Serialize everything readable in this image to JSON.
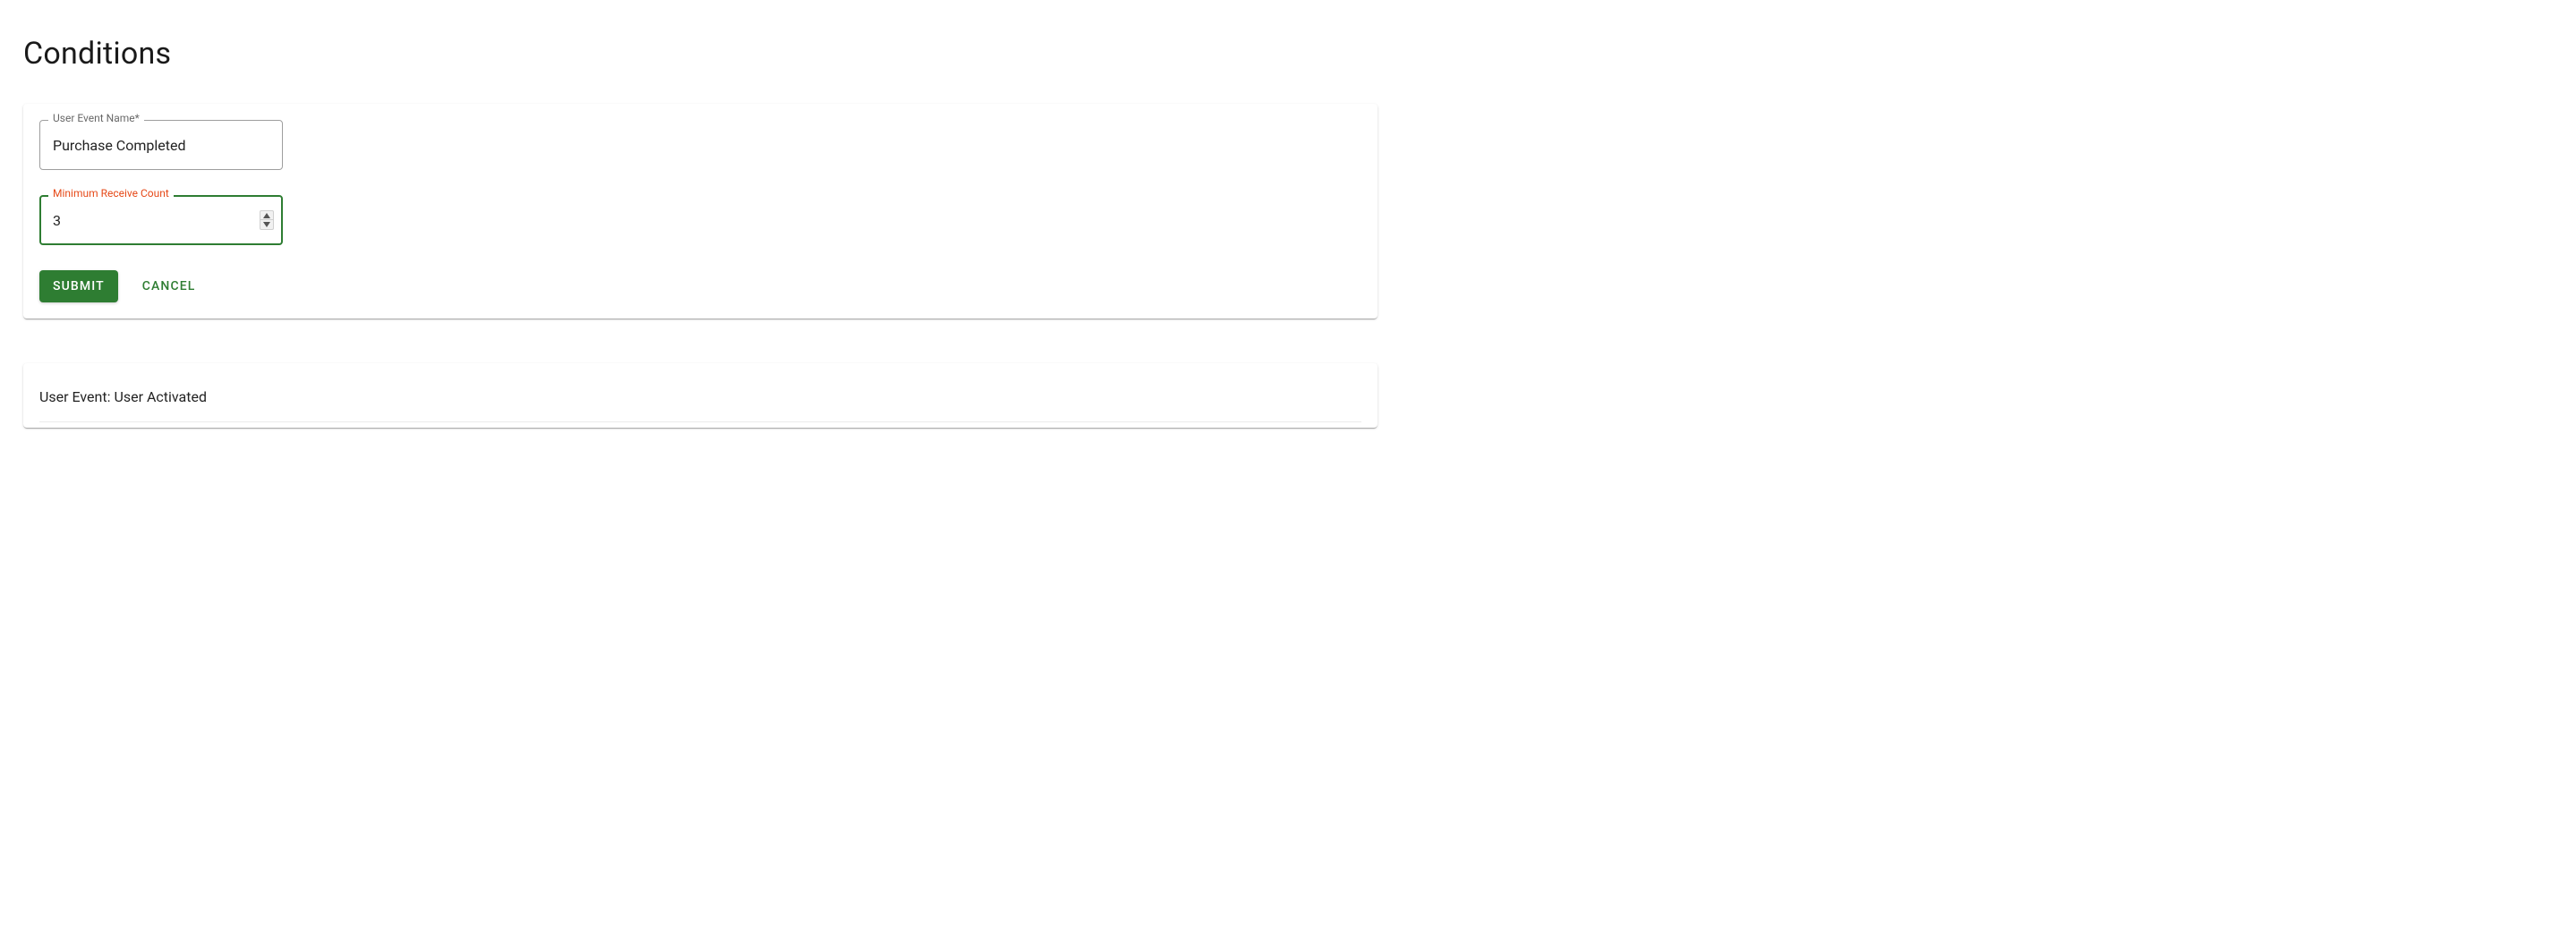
{
  "page": {
    "title": "Conditions"
  },
  "form": {
    "user_event_name": {
      "label": "User Event Name*",
      "value": "Purchase Completed"
    },
    "min_receive_count": {
      "label": "Minimum Receive Count",
      "value": "3"
    },
    "buttons": {
      "submit": "Submit",
      "cancel": "Cancel"
    }
  },
  "conditions_list": [
    {
      "summary": "User Event: User Activated"
    }
  ],
  "colors": {
    "primary": "#2e7d32",
    "accent_label": "#e64a19"
  }
}
